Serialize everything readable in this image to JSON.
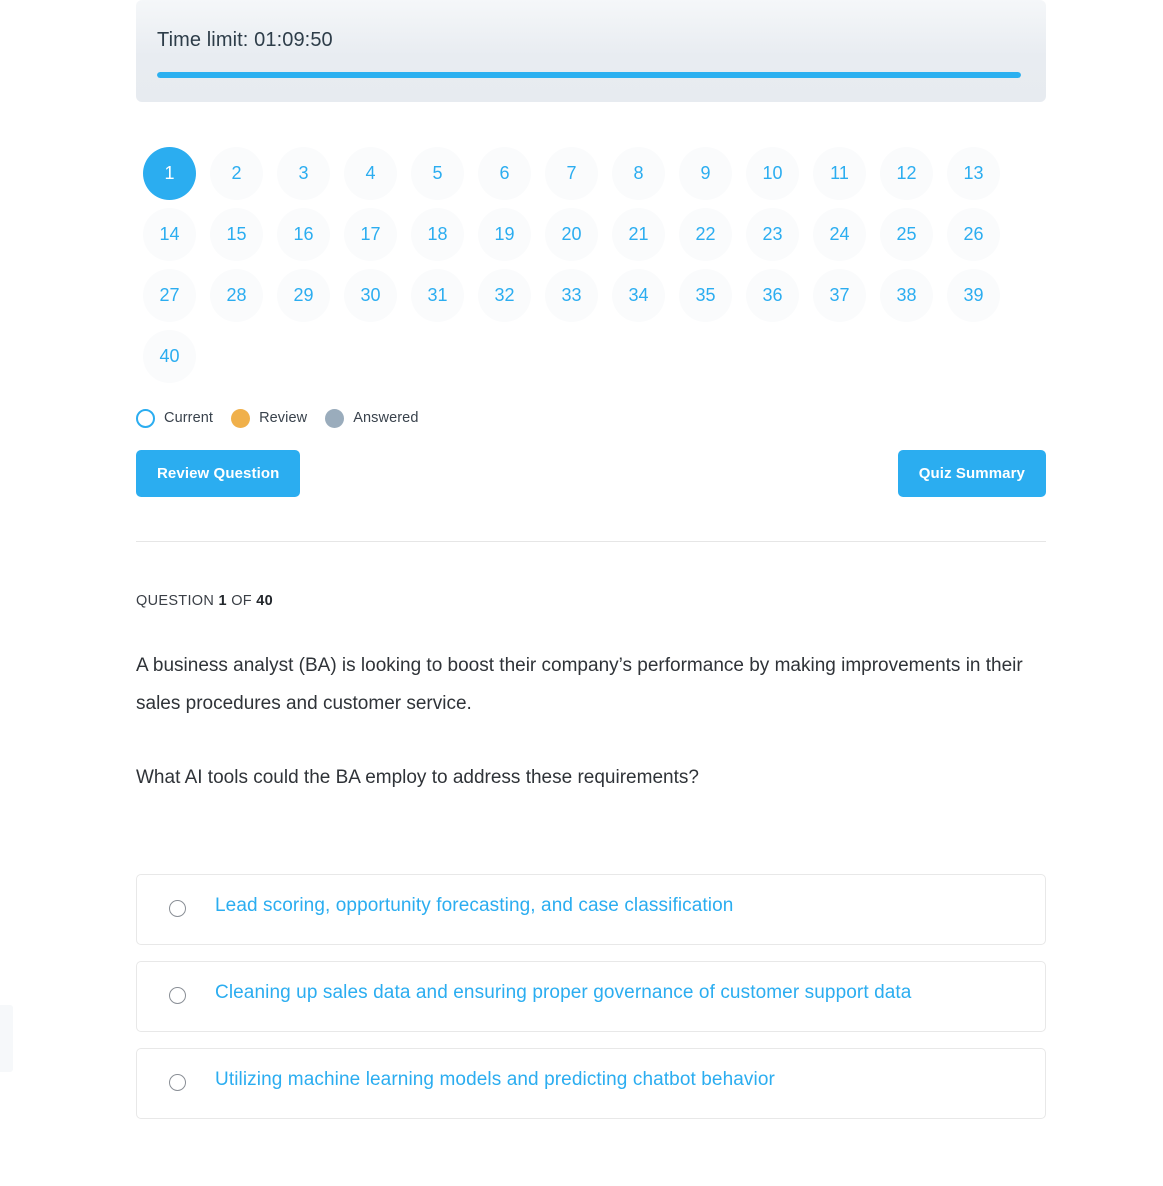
{
  "timer": {
    "label": "Time limit: 01:09:50",
    "progress_percent": 100,
    "bar_color": "#2bb0f0"
  },
  "question_nav": {
    "total": 40,
    "current": 1,
    "numbers": [
      "1",
      "2",
      "3",
      "4",
      "5",
      "6",
      "7",
      "8",
      "9",
      "10",
      "11",
      "12",
      "13",
      "14",
      "15",
      "16",
      "17",
      "18",
      "19",
      "20",
      "21",
      "22",
      "23",
      "24",
      "25",
      "26",
      "27",
      "28",
      "29",
      "30",
      "31",
      "32",
      "33",
      "34",
      "35",
      "36",
      "37",
      "38",
      "39",
      "40"
    ],
    "legend": [
      {
        "label": "Current",
        "state": "current",
        "color": "#2badf0"
      },
      {
        "label": "Review",
        "state": "review",
        "color": "#f0b04a"
      },
      {
        "label": "Answered",
        "state": "answered",
        "color": "#9aacbc"
      }
    ]
  },
  "actions": {
    "review_question": "Review Question",
    "quiz_summary": "Quiz Summary"
  },
  "question": {
    "meta_prefix": "QUESTION",
    "meta_number": "1",
    "meta_middle": "OF",
    "meta_total": "40",
    "paragraph_1": "A business analyst (BA) is looking to boost their company’s performance by making improvements in their sales procedures and customer service.",
    "paragraph_2": "What AI tools could the BA employ to address these requirements?",
    "options": [
      {
        "label": "Lead scoring, opportunity forecasting, and case classification",
        "selected": false
      },
      {
        "label": "Cleaning up sales data and ensuring proper governance of customer support data",
        "selected": false
      },
      {
        "label": "Utilizing machine learning models and predicting chatbot behavior",
        "selected": false
      }
    ]
  }
}
